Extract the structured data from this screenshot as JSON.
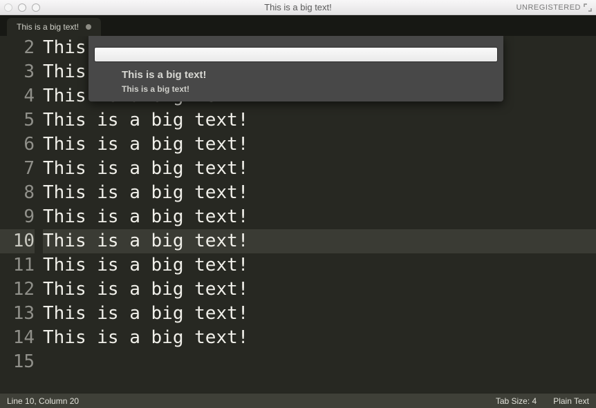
{
  "window": {
    "title": "This is a big text!",
    "registration_badge": "UNREGISTERED"
  },
  "tab": {
    "label": "This is a big text!",
    "dirty": true
  },
  "editor": {
    "active_line_index": 8,
    "lines": [
      {
        "num": "2",
        "text": "This is a big text!"
      },
      {
        "num": "3",
        "text": "This is a big text!"
      },
      {
        "num": "4",
        "text": "This is a big text!"
      },
      {
        "num": "5",
        "text": "This is a big text!"
      },
      {
        "num": "6",
        "text": "This is a big text!"
      },
      {
        "num": "7",
        "text": "This is a big text!"
      },
      {
        "num": "8",
        "text": "This is a big text!"
      },
      {
        "num": "9",
        "text": "This is a big text!"
      },
      {
        "num": "10",
        "text": "This is a big text!"
      },
      {
        "num": "11",
        "text": "This is a big text!"
      },
      {
        "num": "12",
        "text": "This is a big text!"
      },
      {
        "num": "13",
        "text": "This is a big text!"
      },
      {
        "num": "14",
        "text": "This is a big text!"
      },
      {
        "num": "15",
        "text": ""
      }
    ]
  },
  "goto": {
    "input_value": "",
    "results": [
      {
        "title": "This is a big text!"
      },
      {
        "subtitle": "This is a big text!"
      }
    ]
  },
  "status": {
    "position": "Line 10, Column 20",
    "tab_size": "Tab Size: 4",
    "syntax": "Plain Text"
  }
}
